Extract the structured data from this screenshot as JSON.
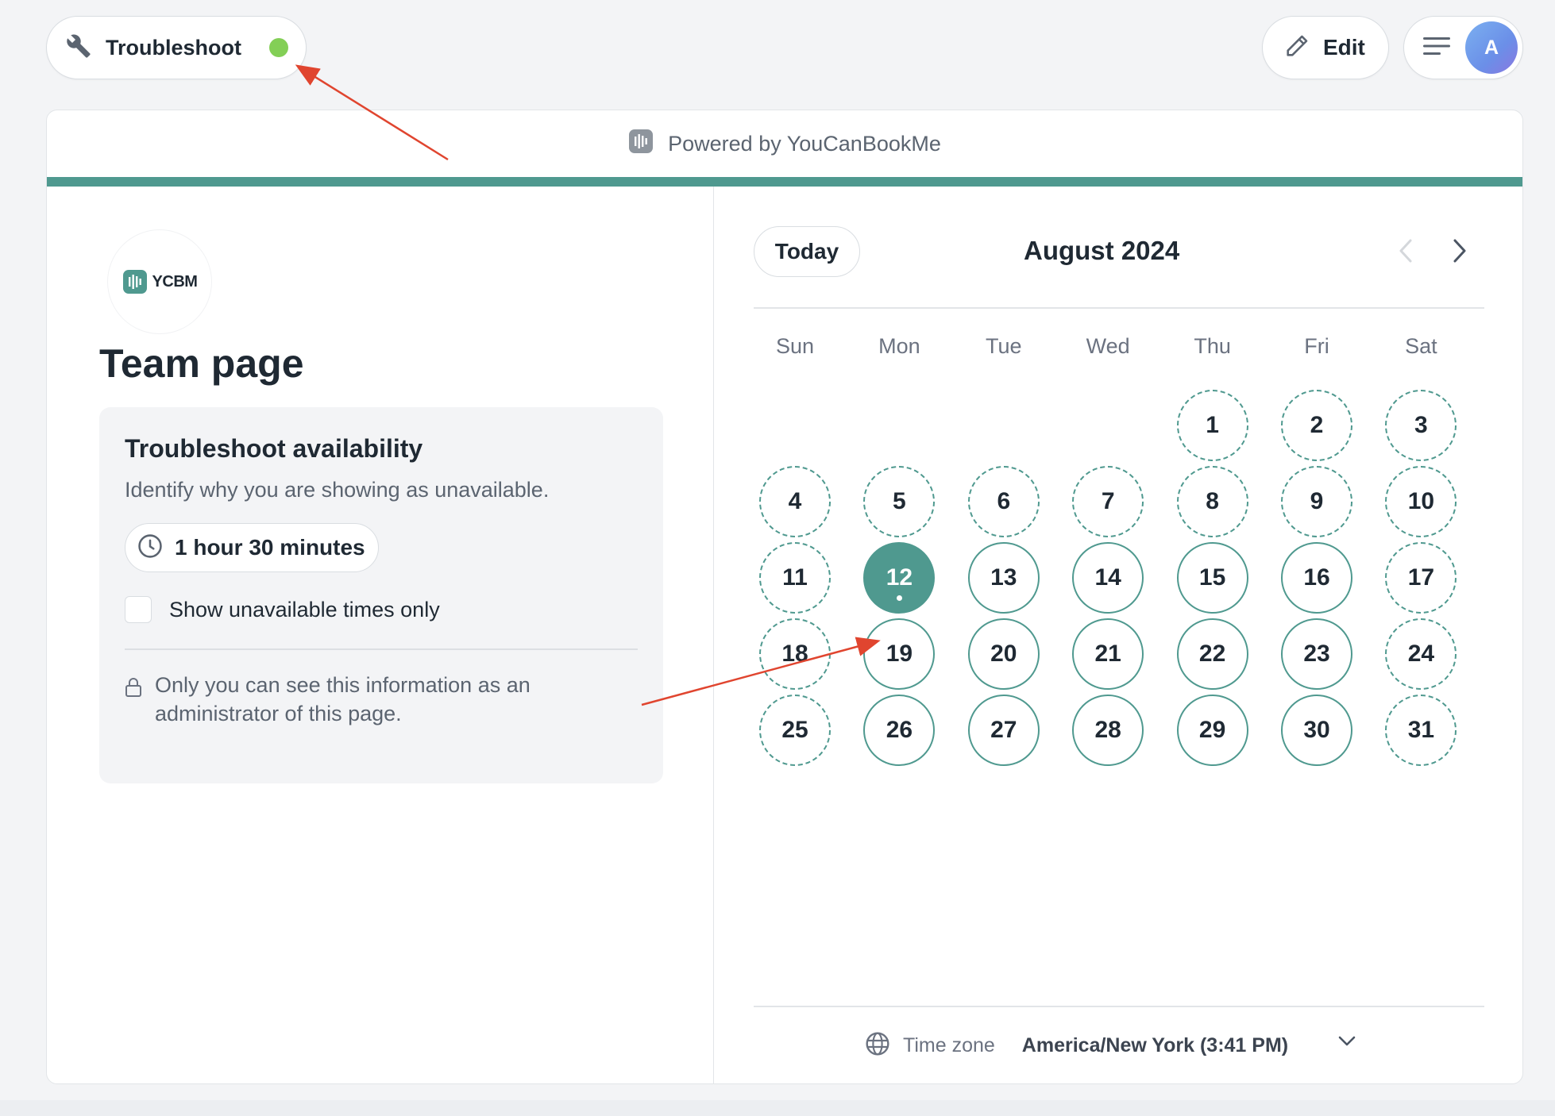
{
  "topbar": {
    "troubleshoot_label": "Troubleshoot",
    "status_color": "#83cf56",
    "edit_label": "Edit",
    "avatar_initial": "A"
  },
  "header": {
    "powered_by": "Powered by YouCanBookMe"
  },
  "brand": {
    "logo_text": "YCBM",
    "accent_color": "#4f998f"
  },
  "left_panel": {
    "page_title": "Team page",
    "troubleshoot_box": {
      "title": "Troubleshoot availability",
      "subtitle": "Identify why you are showing as unavailable.",
      "duration": "1 hour 30 minutes",
      "checkbox_label": "Show unavailable times only",
      "checkbox_checked": false,
      "admin_note": "Only you can see this information as an administrator of this page."
    }
  },
  "calendar": {
    "today_label": "Today",
    "month_title": "August 2024",
    "weekdays": [
      "Sun",
      "Mon",
      "Tue",
      "Wed",
      "Thu",
      "Fri",
      "Sat"
    ],
    "first_weekday_index": 4,
    "days_in_month": 31,
    "selected_day": 12,
    "available_days": [
      12,
      13,
      14,
      15,
      16,
      19,
      20,
      21,
      22,
      23,
      26,
      27,
      28,
      29,
      30
    ],
    "timezone_label": "Time zone",
    "timezone_value": "America/New York (3:41 PM)"
  },
  "icons": {
    "troubleshoot": "wrench-icon",
    "edit": "pencil-icon",
    "menu": "menu-icon",
    "powered": "ycbm-bars-icon",
    "duration": "clock-icon",
    "admin_note": "lock-icon",
    "timezone": "globe-icon",
    "nav_prev": "chevron-left-icon",
    "nav_next": "chevron-right-icon",
    "timezone_dropdown": "chevron-down-icon"
  },
  "annotation_color": "#e0452f"
}
